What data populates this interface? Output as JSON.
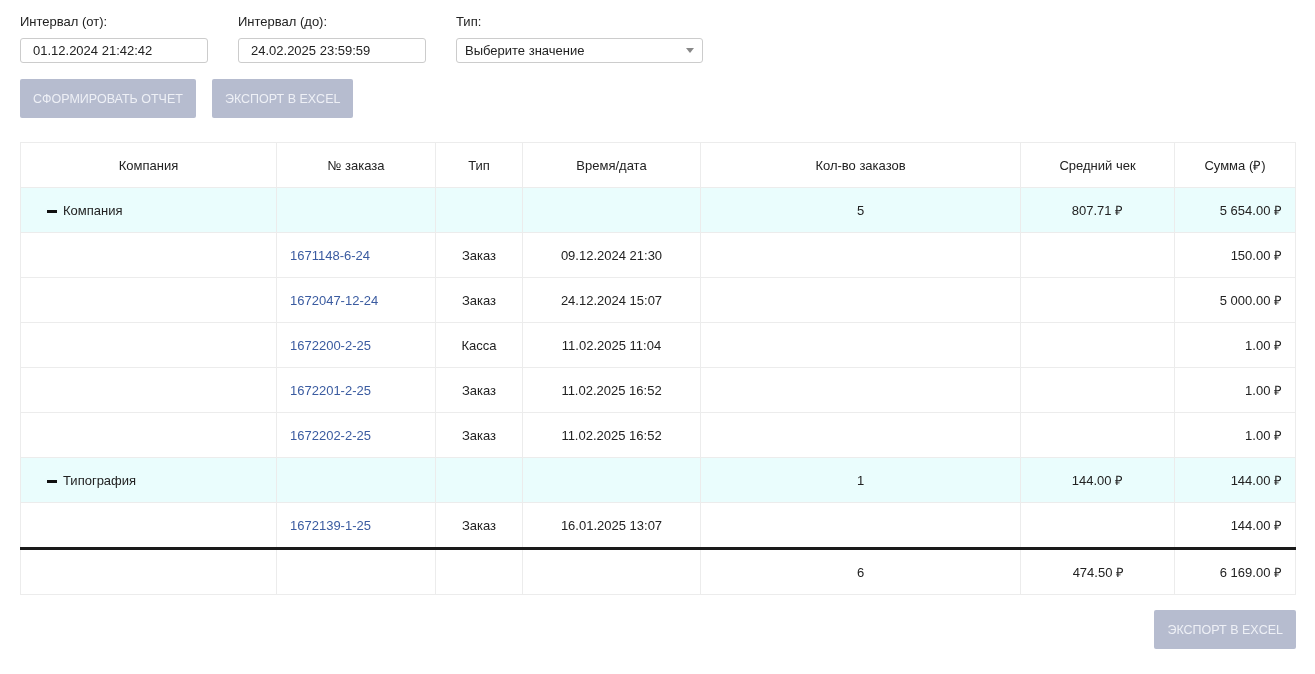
{
  "filters": [
    {
      "kind": "text",
      "label": "Интервал (от):",
      "value": "01.12.2024 21:42:42"
    },
    {
      "kind": "text",
      "label": "Интервал (до):",
      "value": "24.02.2025 23:59:59"
    },
    {
      "kind": "select",
      "label": "Тип:",
      "value": "Выберите значение"
    }
  ],
  "actions": [
    {
      "label": "СФОРМИРОВАТЬ ОТЧЕТ",
      "disabled": true
    },
    {
      "label": "ЭКСПОРТ В EXCEL",
      "disabled": true
    }
  ],
  "table": {
    "columns": [
      "Компания",
      "№ заказа",
      "Тип",
      "Время/дата",
      "Кол-во заказов",
      "Средний чек",
      "Сумма (₽)"
    ],
    "groups": [
      {
        "company": "Компания",
        "expanded": true,
        "count": "5",
        "average": "807.71 ₽",
        "sum": "5 654.00 ₽",
        "orders": [
          {
            "number": "1671148-6-24",
            "type": "Заказ",
            "datetime": "09.12.2024 21:30",
            "sum": "150.00 ₽"
          },
          {
            "number": "1672047-12-24",
            "type": "Заказ",
            "datetime": "24.12.2024 15:07",
            "sum": "5 000.00 ₽"
          },
          {
            "number": "1672200-2-25",
            "type": "Касса",
            "datetime": "11.02.2025 11:04",
            "sum": "1.00 ₽"
          },
          {
            "number": "1672201-2-25",
            "type": "Заказ",
            "datetime": "11.02.2025 16:52",
            "sum": "1.00 ₽"
          },
          {
            "number": "1672202-2-25",
            "type": "Заказ",
            "datetime": "11.02.2025 16:52",
            "sum": "1.00 ₽"
          }
        ]
      },
      {
        "company": "Типография",
        "expanded": true,
        "count": "1",
        "average": "144.00 ₽",
        "sum": "144.00 ₽",
        "orders": [
          {
            "number": "1672139-1-25",
            "type": "Заказ",
            "datetime": "16.01.2025 13:07",
            "sum": "144.00 ₽"
          }
        ]
      }
    ],
    "total": {
      "count": "6",
      "average": "474.50 ₽",
      "sum": "6 169.00 ₽"
    }
  },
  "footer_button": {
    "label": "ЭКСПОРТ В EXCEL",
    "disabled": true
  }
}
